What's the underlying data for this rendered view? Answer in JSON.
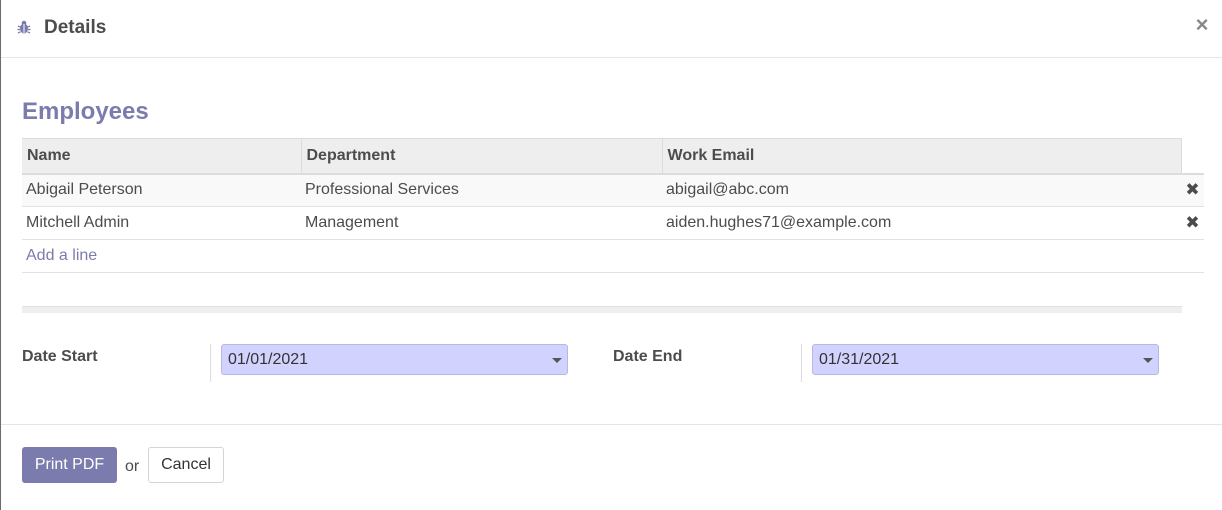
{
  "dialog": {
    "title": "Details",
    "close_label": "×"
  },
  "section": {
    "title": "Employees"
  },
  "table": {
    "columns": [
      "Name",
      "Department",
      "Work Email"
    ],
    "rows": [
      {
        "name": "Abigail Peterson",
        "department": "Professional Services",
        "email": "abigail@abc.com"
      },
      {
        "name": "Mitchell Admin",
        "department": "Management",
        "email": "aiden.hughes71@example.com"
      }
    ],
    "delete_glyph": "✖",
    "add_line": "Add a line"
  },
  "form": {
    "date_start_label": "Date Start",
    "date_start_value": "01/01/2021",
    "date_end_label": "Date End",
    "date_end_value": "01/31/2021"
  },
  "footer": {
    "print_label": "Print PDF",
    "or_text": "or",
    "cancel_label": "Cancel"
  },
  "colors": {
    "accent": "#7c7bad",
    "date_field_bg": "#d2d2ff"
  },
  "icons": {
    "header": "bug-icon",
    "close": "close-icon",
    "delete": "delete-row-icon",
    "dropdown": "caret-down-icon"
  }
}
